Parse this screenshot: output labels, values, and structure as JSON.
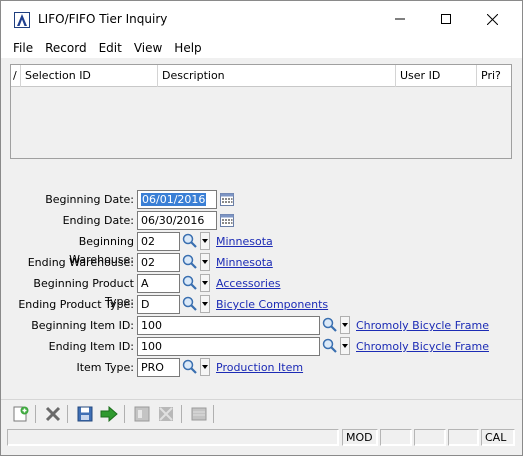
{
  "window": {
    "title": "LIFO/FIFO Tier Inquiry",
    "app_icon": "sage-logo-icon",
    "controls": [
      "minimize-icon",
      "maximize-icon",
      "close-icon"
    ]
  },
  "menu": {
    "items": [
      "File",
      "Record",
      "Edit",
      "View",
      "Help"
    ]
  },
  "grid": {
    "marker": "/",
    "columns": [
      "Selection ID",
      "Description",
      "User ID",
      "Pri?"
    ]
  },
  "form": {
    "beginning_date": {
      "label": "Beginning Date:",
      "value": "06/01/2016"
    },
    "ending_date": {
      "label": "Ending Date:",
      "value": "06/30/2016"
    },
    "beginning_warehouse": {
      "label": "Beginning Warehouse:",
      "value": "02",
      "link": "Minnesota"
    },
    "ending_warehouse": {
      "label": "Ending Warehouse:",
      "value": "02",
      "link": "Minnesota"
    },
    "beginning_product_type": {
      "label": "Beginning Product Type:",
      "value": "A",
      "link": "Accessories"
    },
    "ending_product_type": {
      "label": "Ending Product Type:",
      "value": "D",
      "link": "Bicycle Components"
    },
    "beginning_item_id": {
      "label": "Beginning Item ID:",
      "value": "100",
      "link": "Chromoly Bicycle Frame"
    },
    "ending_item_id": {
      "label": "Ending Item ID:",
      "value": "100",
      "link": "Chromoly Bicycle Frame"
    },
    "item_type": {
      "label": "Item Type:",
      "value": "PRO",
      "link": "Production Item"
    }
  },
  "toolbar": {
    "icons": [
      "new-record-icon",
      "delete-icon",
      "save-icon",
      "run-icon",
      "view-disabled-icon",
      "grid-disabled-icon",
      "panel-disabled-icon"
    ]
  },
  "statusbar": {
    "panels": [
      "",
      "MOD",
      "",
      "",
      "",
      "CAL"
    ]
  },
  "colors": {
    "link": "#1c2bb5",
    "selection": "#3a7fd5",
    "window_bg": "#f0f0f0"
  }
}
